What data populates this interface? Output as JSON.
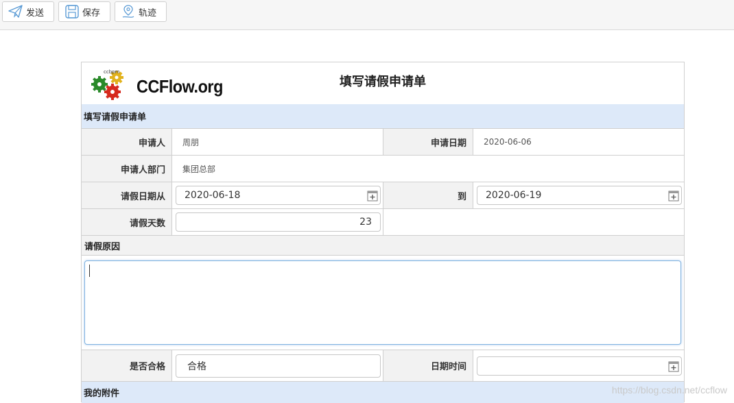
{
  "toolbar": {
    "send_label": "发送",
    "save_label": "保存",
    "track_label": "轨迹"
  },
  "header": {
    "logo_text": "CCFlow.org",
    "logo_small": "ccbpm",
    "title": "填写请假申请单"
  },
  "sections": {
    "main": "填写请假申请单",
    "attachments": "我的附件"
  },
  "fields": {
    "applicant_label": "申请人",
    "applicant_value": "周朋",
    "apply_date_label": "申请日期",
    "apply_date_value": "2020-06-06",
    "dept_label": "申请人部门",
    "dept_value": "集团总部",
    "leave_from_label": "请假日期从",
    "leave_from_value": "2020-06-18",
    "leave_to_label": "到",
    "leave_to_value": "2020-06-19",
    "days_label": "请假天数",
    "days_value": "23",
    "reason_label": "请假原因",
    "qualified_label": "是否合格",
    "qualified_value": "合格",
    "datetime_label": "日期时间",
    "datetime_value": ""
  },
  "watermark": "https://blog.csdn.net/ccflow",
  "colors": {
    "section_bg": "#dde9f9",
    "label_bg": "#f2f2f2",
    "focus_border": "#7fb2e0"
  }
}
